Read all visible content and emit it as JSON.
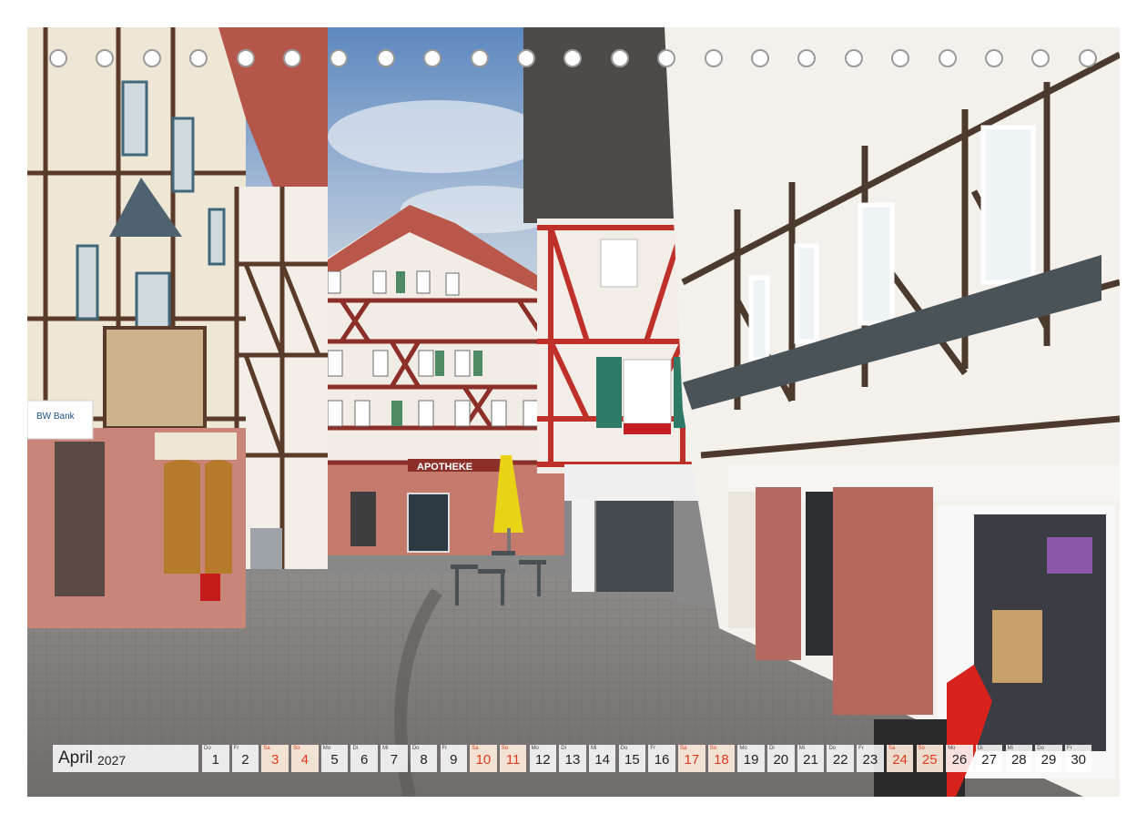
{
  "calendar": {
    "month": "April",
    "year": "2027",
    "days": [
      {
        "wd": "Do",
        "n": "1",
        "type": "normal"
      },
      {
        "wd": "Fr",
        "n": "2",
        "type": "normal"
      },
      {
        "wd": "Sa",
        "n": "3",
        "type": "weekend"
      },
      {
        "wd": "So",
        "n": "4",
        "type": "weekend"
      },
      {
        "wd": "Mo",
        "n": "5",
        "type": "normal"
      },
      {
        "wd": "Di",
        "n": "6",
        "type": "normal"
      },
      {
        "wd": "Mi",
        "n": "7",
        "type": "normal"
      },
      {
        "wd": "Do",
        "n": "8",
        "type": "normal"
      },
      {
        "wd": "Fr",
        "n": "9",
        "type": "normal"
      },
      {
        "wd": "Sa",
        "n": "10",
        "type": "weekend"
      },
      {
        "wd": "So",
        "n": "11",
        "type": "weekend"
      },
      {
        "wd": "Mo",
        "n": "12",
        "type": "normal"
      },
      {
        "wd": "Di",
        "n": "13",
        "type": "normal"
      },
      {
        "wd": "Mi",
        "n": "14",
        "type": "normal"
      },
      {
        "wd": "Do",
        "n": "15",
        "type": "normal"
      },
      {
        "wd": "Fr",
        "n": "16",
        "type": "normal"
      },
      {
        "wd": "Sa",
        "n": "17",
        "type": "weekend"
      },
      {
        "wd": "So",
        "n": "18",
        "type": "weekend"
      },
      {
        "wd": "Mo",
        "n": "19",
        "type": "normal"
      },
      {
        "wd": "Di",
        "n": "20",
        "type": "normal"
      },
      {
        "wd": "Mi",
        "n": "21",
        "type": "normal"
      },
      {
        "wd": "Do",
        "n": "22",
        "type": "normal"
      },
      {
        "wd": "Fr",
        "n": "23",
        "type": "normal"
      },
      {
        "wd": "Sa",
        "n": "24",
        "type": "weekend"
      },
      {
        "wd": "So",
        "n": "25",
        "type": "weekend"
      },
      {
        "wd": "Mo",
        "n": "26",
        "type": "normal"
      },
      {
        "wd": "Di",
        "n": "27",
        "type": "normal"
      },
      {
        "wd": "Mi",
        "n": "28",
        "type": "normal"
      },
      {
        "wd": "Do",
        "n": "29",
        "type": "normal"
      },
      {
        "wd": "Fr",
        "n": "30",
        "type": "normal"
      }
    ]
  },
  "photo": {
    "apotheke_sign": "APOTHEKE",
    "bank_sign": "BW Bank"
  },
  "binding_holes": 23,
  "colors": {
    "weekend_text": "#e03a1e",
    "timber": "#8c2f28",
    "sky": "#7aa0c8"
  }
}
